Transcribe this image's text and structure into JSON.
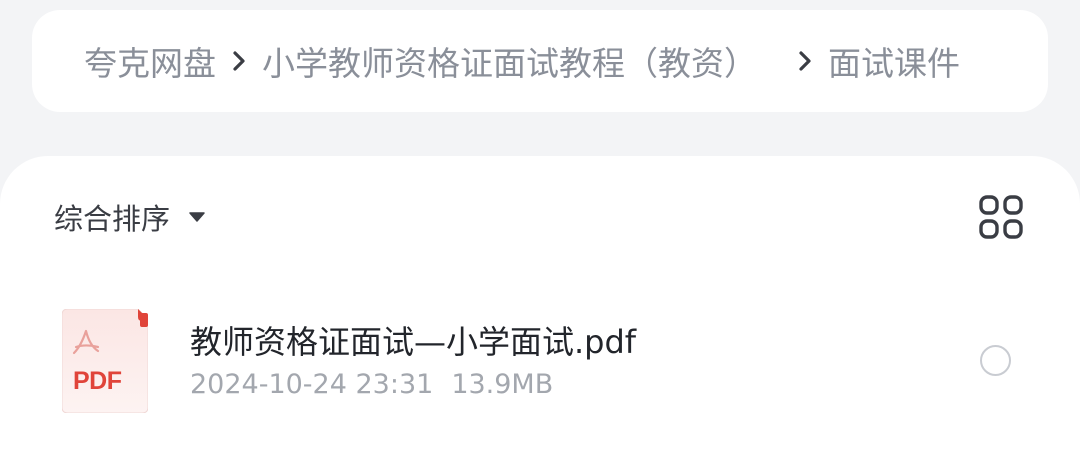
{
  "breadcrumb": {
    "root": "夸克网盘",
    "folder": "小学教师资格证面试教程（教资）",
    "current": "面试课件"
  },
  "toolbar": {
    "sort_label": "综合排序"
  },
  "files": [
    {
      "name": "教师资格证面试—小学面试.pdf",
      "date": "2024-10-24 23:31",
      "size": "13.9MB",
      "type_badge": "PDF"
    }
  ],
  "colors": {
    "background": "#f3f4f6",
    "pdf_red": "#e0443a",
    "breadcrumb_text": "#8a8f99"
  },
  "icons": [
    "chevron-right-icon",
    "caret-down-icon",
    "grid-view-icon",
    "pdf-file-icon",
    "select-circle-icon"
  ]
}
